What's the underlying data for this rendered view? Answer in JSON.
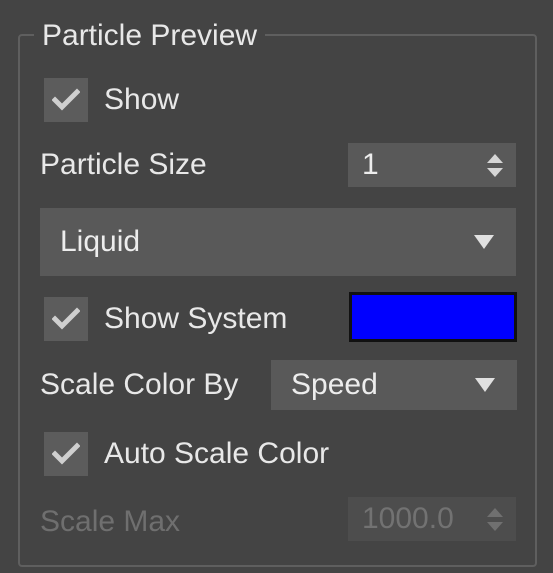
{
  "group": {
    "title": "Particle Preview"
  },
  "show": {
    "label": "Show",
    "checked": true
  },
  "particle_size": {
    "label": "Particle Size",
    "value": "1"
  },
  "particle_type": {
    "selected": "Liquid"
  },
  "show_system": {
    "label": "Show System",
    "checked": true,
    "color": "#0000ff"
  },
  "scale_color_by": {
    "label": "Scale Color By",
    "selected": "Speed"
  },
  "auto_scale_color": {
    "label": "Auto Scale Color",
    "checked": true
  },
  "scale_max": {
    "label": "Scale Max",
    "value": "1000.0",
    "disabled": true
  },
  "icons": {
    "checkmark": "checkmark-icon",
    "dropdown": "triangle-down-icon",
    "spinner": "up-down-arrows-icon"
  }
}
